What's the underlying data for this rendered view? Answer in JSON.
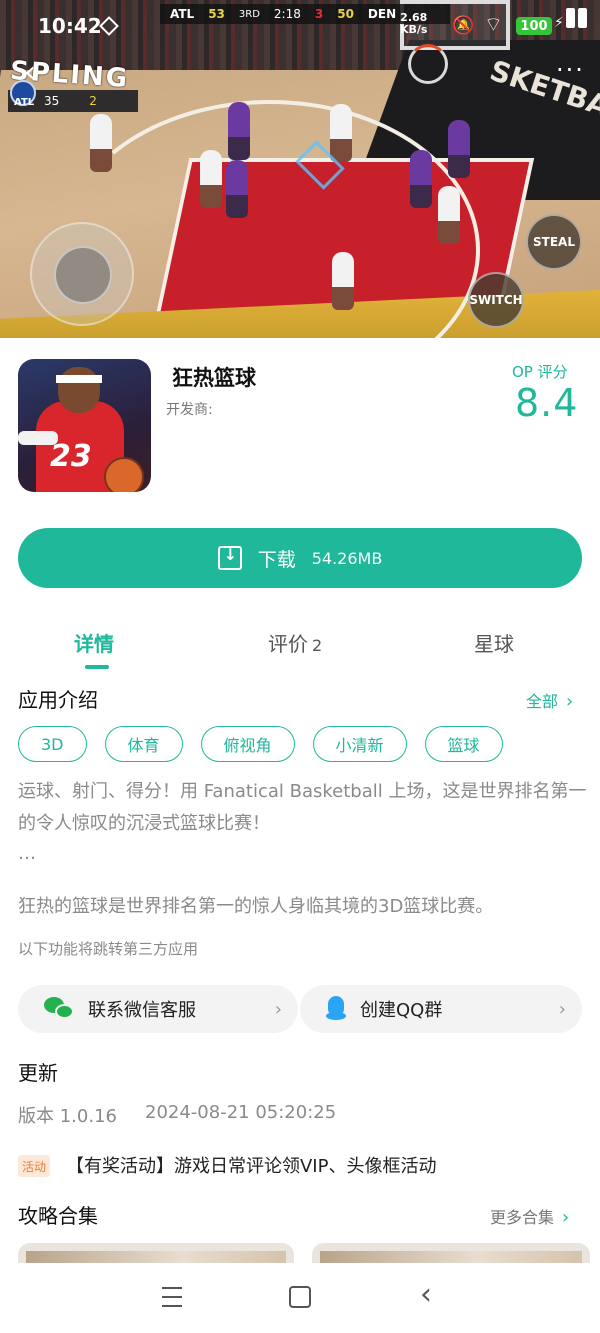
{
  "status_bar": {
    "time": "10:42",
    "net_speed_value": "2.68",
    "net_speed_unit": "KB/s",
    "battery": "100"
  },
  "game_screenshot": {
    "scoreboard": {
      "team_left": "ATL",
      "score_left": "53",
      "quarter": "3RD",
      "clock": "2:18",
      "shot_clock": "3",
      "score_right": "50",
      "team_right": "DEN"
    },
    "mini_score": {
      "team": "ATL",
      "points": "35",
      "fouls": "2"
    },
    "banner_left": "SPLING",
    "banner_right": "SKETBA",
    "button_steal": "STEAL",
    "button_switch": "SWITCH"
  },
  "app": {
    "name": "狂热篮球",
    "developer_label": "开发商:",
    "score_label": "OP 评分",
    "score_value": "8.4",
    "icon_number": "23"
  },
  "download": {
    "label": "下载",
    "size": "54.26MB"
  },
  "tabs": [
    {
      "label": "详情",
      "active": true
    },
    {
      "label": "评价",
      "count": "2"
    },
    {
      "label": "星球"
    }
  ],
  "intro": {
    "title": "应用介绍",
    "all_link": "全部",
    "tags": [
      "3D",
      "体育",
      "俯视角",
      "小清新",
      "篮球"
    ],
    "description": "运球、射门、得分！用 Fanatical Basketball 上场，这是世界排名第一的令人惊叹的沉浸式篮球比赛！",
    "ellipsis": "…",
    "description2": "狂热的篮球是世界排名第一的惊人身临其境的3D篮球比赛。",
    "third_party_note": "以下功能将跳转第三方应用",
    "contacts": [
      {
        "label": "联系微信客服",
        "icon": "wechat-icon"
      },
      {
        "label": "创建QQ群",
        "icon": "qq-icon"
      }
    ]
  },
  "update": {
    "title": "更新",
    "version": "版本 1.0.16",
    "date": "2024-08-21 05:20:25"
  },
  "activity": {
    "badge": "活动",
    "text": "【有奖活动】游戏日常评论领VIP、头像框活动"
  },
  "guides": {
    "title": "攻略合集",
    "more_link": "更多合集"
  },
  "colors": {
    "accent": "#1fb89a",
    "wechat": "#22b14c",
    "qq": "#2aa4f4"
  }
}
